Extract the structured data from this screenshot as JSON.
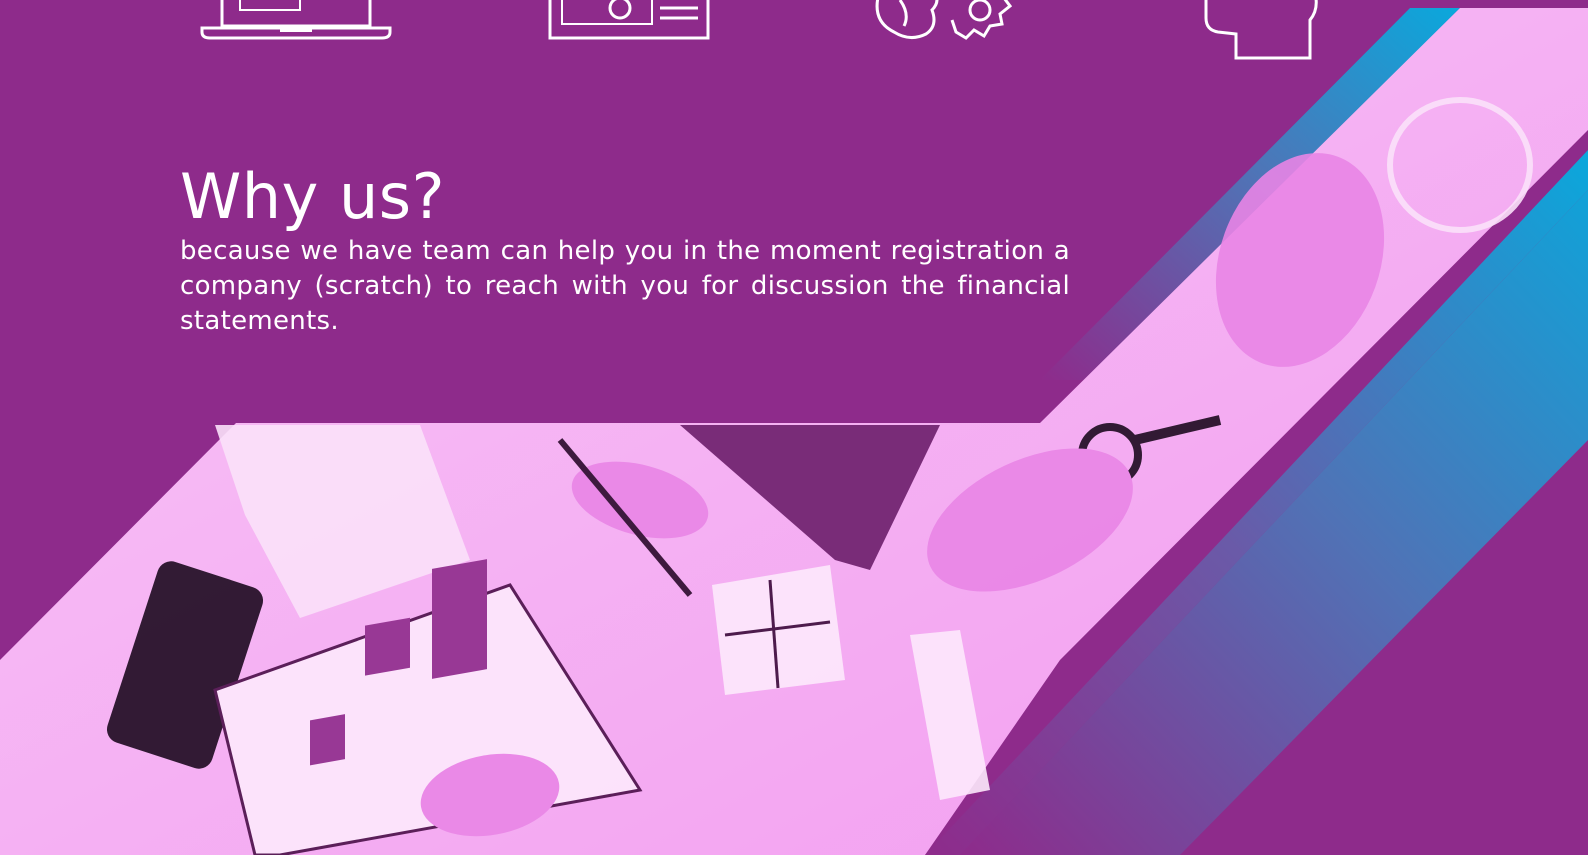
{
  "section": {
    "title": "Why us?",
    "description": "because we have team can help you in the moment registration a company (scratch) to reach with you for discussion the financial statements."
  },
  "icons": [
    "laptop-icon",
    "settings-dashboard-icon",
    "brain-gear-icon",
    "head-profile-icon"
  ],
  "colors": {
    "background": "#8e2b8b",
    "accent_blue": "#0fa3d9",
    "photo_tint": "#f5b2f4",
    "text": "#ffffff"
  }
}
